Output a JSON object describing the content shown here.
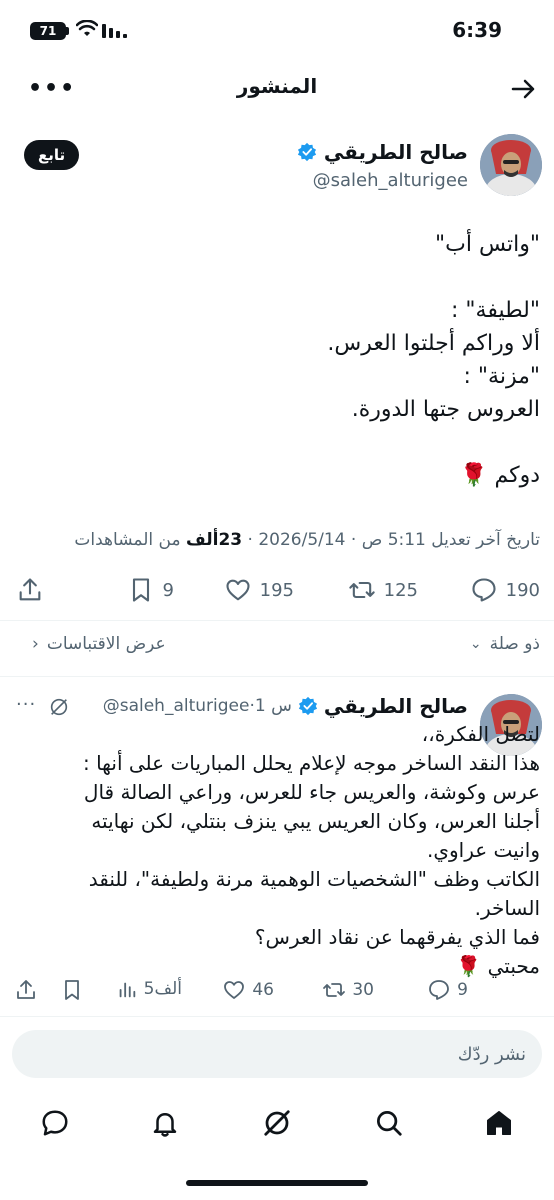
{
  "status_bar": {
    "time": "6:39",
    "battery": "71"
  },
  "header": {
    "title": "المنشور"
  },
  "post": {
    "author_name": "صالح الطريقي",
    "author_handle": "@saleh_alturigee",
    "follow_label": "تابع",
    "body_lines": [
      "\"واتس أب\"",
      "",
      "\"لطيفة\" :",
      "ألا وراكم أجلتوا العرس.",
      "\"مزنة\" :",
      "العروس جتها الدورة.",
      "",
      "دوكم 🌹"
    ],
    "edited_time": "تاريخ آخر تعديل 5:11 ص",
    "date": "2026/5/14",
    "views_count": "23ألف",
    "views_label": "من المشاهدات",
    "replies": "190",
    "reposts": "125",
    "likes": "195",
    "bookmarks": "9"
  },
  "thread": {
    "related_label": "ذو صلة",
    "quotes_label": "عرض الاقتباسات"
  },
  "reply": {
    "author_name": "صالح الطريقي",
    "handle_time": "@saleh_alturigee·1 س",
    "body_lines": [
      "لتصل الفكرة،،",
      "هذا النقد الساخر موجه لإعلام يحلل المباريات على أنها :",
      "عرس وكوشة، والعريس جاء للعرس، وراعي الصالة قال",
      "أجلنا العرس، وكان العريس يبي ينزف بنتلي، لكن نهايته",
      "وانيت عراوي.",
      "الكاتب وظف \"الشخصيات الوهمية مرنة ولطيفة\"، للنقد",
      "الساخر.",
      "فما الذي يفرقهما عن نقاد العرس؟",
      "محبتي 🌹"
    ],
    "replies": "9",
    "reposts": "30",
    "likes": "46",
    "views": "5ألف"
  },
  "composer": {
    "placeholder": "نشر ردّك"
  },
  "colors": {
    "text": "#0f1419",
    "muted": "#536471",
    "verified": "#1d9bf0",
    "divider": "#eff3f4"
  }
}
